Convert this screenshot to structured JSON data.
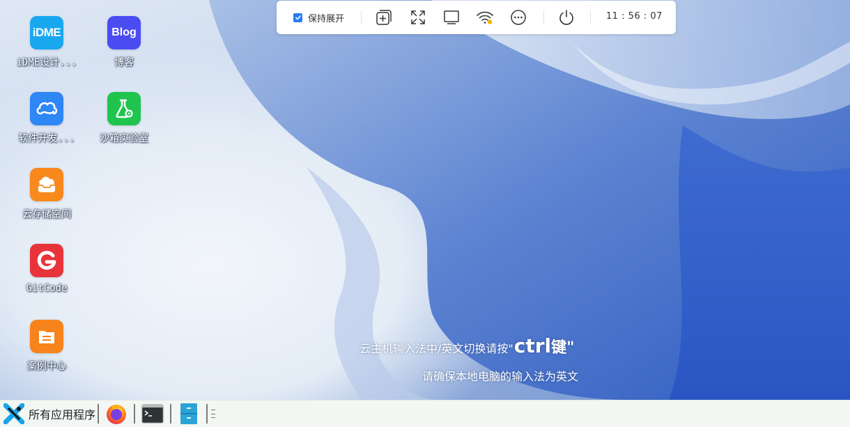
{
  "desktop": {
    "icons": [
      {
        "label": "iDME设计...",
        "glyph": "iDME",
        "color": "#19a7f0",
        "icon": "idme-icon"
      },
      {
        "label": "博客",
        "glyph": "Blog",
        "color": "#4a4cf2",
        "icon": "blog-icon"
      },
      {
        "label": "软件开发...",
        "glyph": "",
        "color": "#2f86f5",
        "icon": "cloud-dev-icon"
      },
      {
        "label": "沙箱实验室",
        "glyph": "",
        "color": "#1fc44f",
        "icon": "flask-icon"
      },
      {
        "label": "云存储空间",
        "glyph": "",
        "color": "#f7891d",
        "icon": "cloud-storage-icon"
      },
      {
        "label": "GitCode",
        "glyph": "",
        "color": "#e8333b",
        "icon": "gitcode-icon"
      },
      {
        "label": "案例中心",
        "glyph": "",
        "color": "#f7831c",
        "icon": "case-center-icon"
      }
    ]
  },
  "toolbar": {
    "keep_expanded_label": "保持展开",
    "keep_expanded_checked": true,
    "buttons": [
      "add-window-icon",
      "fullscreen-icon",
      "monitor-icon",
      "wifi-icon",
      "more-icon",
      "power-icon"
    ],
    "clock": "11 : 56 : 07",
    "accent": "#2a7bf4"
  },
  "hint": {
    "line1_prefix": "云主机输入法中/英文切换请按\"",
    "line1_key": "ctrl",
    "line1_suffix": "键\"",
    "line2": "请确保本地电脑的输入法为英文"
  },
  "taskbar": {
    "start_label": "所有应用程序",
    "apps": [
      "firefox-icon",
      "terminal-icon",
      "file-manager-icon"
    ]
  }
}
